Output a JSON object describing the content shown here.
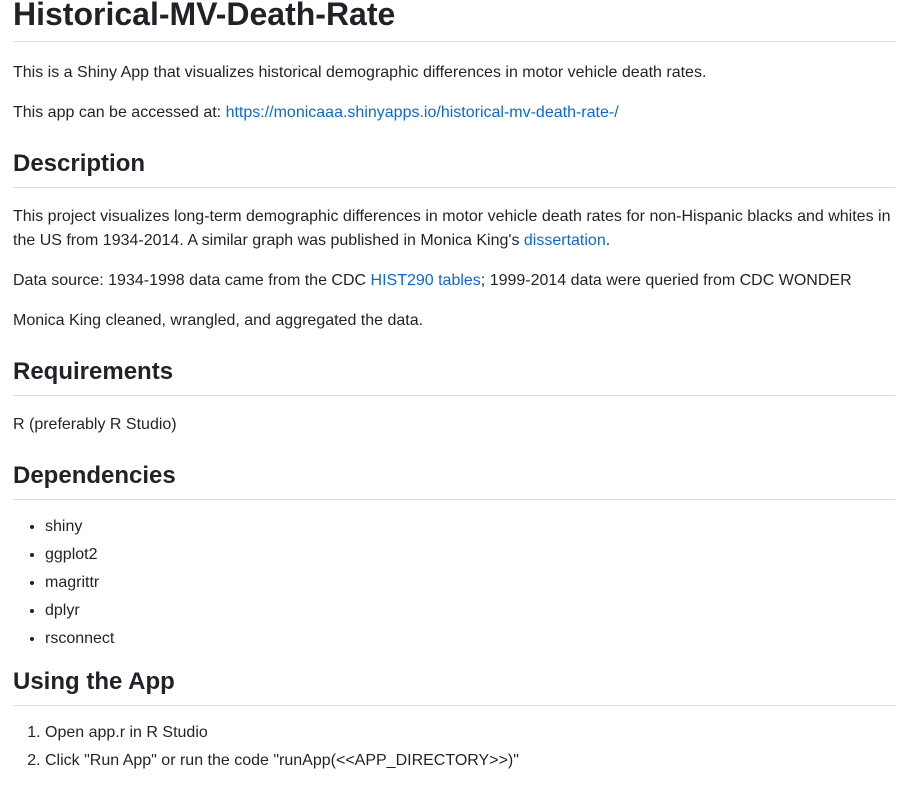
{
  "title": "Historical-MV-Death-Rate",
  "intro": "This is a Shiny App that visualizes historical demographic differences in motor vehicle death rates.",
  "access": {
    "prefix": "This app can be accessed at: ",
    "link_text": "https://monicaaa.shinyapps.io/historical-mv-death-rate-/"
  },
  "description": {
    "heading": "Description",
    "p1_text": "This project visualizes long-term demographic differences in motor vehicle death rates for non-Hispanic blacks and whites in the US from 1934-2014. A similar graph was published in Monica King's ",
    "p1_link": "dissertation",
    "p1_end": ".",
    "p2_prefix": "Data source: 1934-1998 data came from the CDC ",
    "p2_link": "HIST290 tables",
    "p2_suffix": "; 1999-2014 data were queried from CDC WONDER",
    "p3": "Monica King cleaned, wrangled, and aggregated the data."
  },
  "requirements": {
    "heading": "Requirements",
    "text": "R (preferably R Studio)"
  },
  "dependencies": {
    "heading": "Dependencies",
    "items": [
      "shiny",
      "ggplot2",
      "magrittr",
      "dplyr",
      "rsconnect"
    ]
  },
  "using": {
    "heading": "Using the App",
    "steps": [
      "Open app.r in R Studio",
      "Click \"Run App\" or run the code \"runApp(<<APP_DIRECTORY>>)\""
    ]
  }
}
